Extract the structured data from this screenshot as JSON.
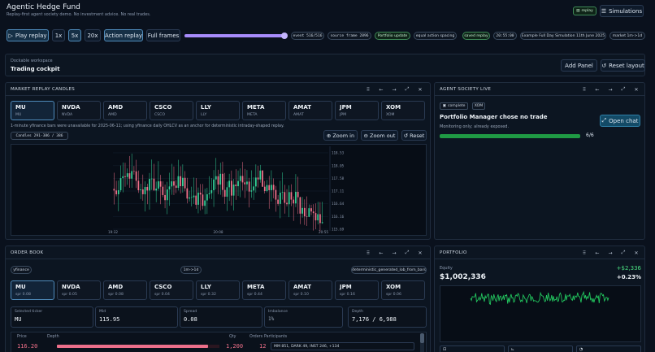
{
  "header": {
    "title": "Agentic Hedge Fund",
    "subtitle": "Replay-first agent society demo. No investment advice. No real trades.",
    "replay_badge": "replay",
    "simulations_label": "Simulations"
  },
  "toolbar": {
    "play_label": "Play replay",
    "speeds": [
      "1x",
      "5x",
      "20x"
    ],
    "active_speed": "5x",
    "action_replay_label": "Action replay",
    "full_frames_label": "Full frames",
    "replay_progress_fraction": 0.98,
    "pills": {
      "event": "event 516/516",
      "source": "source frame 2896",
      "portfolio": "Portfolio update",
      "spacing": "equal action spacing",
      "saved": "saved replay",
      "time": "20:55:00",
      "sim_name": "Example Full Day Simulation 11th June 2025",
      "market": "market 1m->1d"
    }
  },
  "workspace": {
    "label": "Dockable workspace",
    "title": "Trading cockpit",
    "add_panel_label": "Add Panel",
    "reset_layout_label": "Reset layout"
  },
  "market_panel": {
    "title": "MARKET REPLAY CANDLES",
    "tickers": [
      {
        "sym": "MU",
        "sub": "MU"
      },
      {
        "sym": "NVDA",
        "sub": "NVDA"
      },
      {
        "sym": "AMD",
        "sub": "AMD"
      },
      {
        "sym": "CSCO",
        "sub": "CSCO"
      },
      {
        "sym": "LLY",
        "sub": "LLY"
      },
      {
        "sym": "META",
        "sub": "META"
      },
      {
        "sym": "AMAT",
        "sub": "AMAT"
      },
      {
        "sym": "JPM",
        "sub": "JPM"
      },
      {
        "sym": "XOM",
        "sub": "XOM"
      }
    ],
    "selected": "MU",
    "note": "1-minute yfinance bars were unavailable for 2025-06-11; using yfinance daily OHLCV as an anchor for deterministic intraday-shaped replay.",
    "candles_badge": "Candles 291-386 / 386",
    "zoom_in_label": "Zoom in",
    "zoom_out_label": "Zoom out",
    "reset_label": "Reset"
  },
  "chart_data": {
    "type": "candlestick",
    "title": "",
    "xlabel": "",
    "ylabel": "",
    "ylim": [
      115.75,
      118.65
    ],
    "y_ticks": [
      "118.53",
      "118.05",
      "117.58",
      "117.11",
      "116.64",
      "116.16",
      "115.69"
    ],
    "y_tick_values": [
      118.53,
      118.05,
      117.58,
      117.11,
      116.64,
      116.16,
      115.69
    ],
    "x_ticks": [
      "19:32",
      "20:08",
      "20:55"
    ],
    "x_tick_positions": [
      0,
      0.5,
      1
    ],
    "series": [
      {
        "opens": [
          117.19,
          117.13,
          116.99,
          117.14,
          117.59,
          117.66,
          117.63,
          117.77,
          117.57,
          117.85,
          117.84,
          117.49,
          117.14,
          117.17,
          116.99,
          117.26,
          117.13,
          117.56,
          117.57,
          117.13,
          117.2,
          117.47,
          117.27,
          116.96,
          116.77,
          117.17,
          117.28,
          117.47,
          117.31,
          117.23,
          117.66,
          117.29,
          117.6,
          117.21,
          116.83,
          116.87,
          116.88,
          116.94,
          116.6,
          117.05,
          116.98,
          116.56,
          116.76,
          116.99,
          117.03,
          117.14,
          117.54,
          117.66,
          117.35,
          117.75,
          117.15,
          116.9,
          117.25,
          117.49,
          116.94,
          117.35,
          117.29,
          117.48,
          117.67,
          117.43,
          117.36,
          117.46,
          117.09,
          117.13,
          117.28,
          117.61,
          117.54,
          117.87,
          117.27,
          117.11,
          117.33,
          117.14,
          117.34,
          117.15,
          116.79,
          116.63,
          117.05,
          117.07,
          116.67,
          116.62,
          117.07,
          116.79,
          116.65,
          117.08,
          116.88,
          116.27,
          116.48,
          116.17,
          116.15,
          116.47,
          116.35,
          116.29,
          116.02,
          116.25,
          115.92
        ],
        "closes": [
          117.13,
          116.99,
          117.14,
          117.59,
          117.66,
          117.63,
          117.77,
          117.57,
          117.85,
          117.84,
          117.49,
          117.14,
          117.17,
          116.99,
          117.26,
          117.13,
          117.56,
          117.57,
          117.13,
          117.2,
          117.47,
          117.27,
          116.96,
          116.77,
          117.17,
          117.28,
          117.47,
          117.31,
          117.23,
          117.66,
          117.29,
          117.6,
          117.21,
          116.83,
          116.87,
          116.88,
          116.94,
          116.6,
          117.05,
          116.98,
          116.56,
          116.76,
          116.99,
          117.03,
          117.14,
          117.54,
          117.66,
          117.35,
          117.75,
          117.15,
          116.9,
          117.25,
          117.49,
          116.94,
          117.35,
          117.29,
          117.48,
          117.67,
          117.43,
          117.36,
          117.46,
          117.09,
          117.13,
          117.28,
          117.61,
          117.54,
          117.87,
          117.27,
          117.11,
          117.33,
          117.14,
          117.34,
          117.15,
          116.79,
          116.63,
          117.05,
          117.07,
          116.67,
          116.62,
          117.07,
          116.79,
          116.65,
          117.08,
          116.88,
          116.27,
          116.48,
          116.17,
          116.15,
          116.47,
          116.35,
          116.29,
          116.02,
          116.25,
          115.92,
          115.95
        ],
        "highs": [
          117.79,
          117.49,
          117.5,
          118.06,
          118.17,
          118.16,
          117.95,
          118.41,
          118.5,
          118.04,
          118.27,
          117.87,
          117.38,
          117.72,
          117.47,
          117.38,
          117.78,
          118.28,
          118.12,
          117.46,
          118.22,
          117.71,
          117.47,
          117.35,
          117.45,
          117.79,
          118.12,
          118.02,
          117.51,
          118.27,
          118.03,
          118.1,
          117.85,
          117.6,
          117.12,
          117.27,
          117.61,
          117.59,
          117.24,
          117.37,
          117.37,
          117.2,
          117.23,
          117.66,
          117.59,
          117.89,
          118.34,
          117.9,
          118.16,
          118.2,
          117.78,
          117.46,
          117.75,
          117.87,
          117.56,
          117.92,
          117.87,
          117.95,
          118.19,
          117.93,
          117.89,
          117.6,
          117.88,
          117.62,
          118.1,
          118.05,
          118.08,
          117.89,
          117.48,
          117.52,
          117.67,
          117.88,
          117.58,
          117.3,
          116.96,
          117.49,
          117.8,
          117.34,
          117.18,
          117.32,
          117.36,
          116.91,
          117.74,
          117.64,
          116.9,
          116.89,
          116.8,
          116.91,
          116.61,
          116.6,
          116.62,
          116.65,
          116.71,
          116.7,
          116.71
        ],
        "lows": [
          116.61,
          116.91,
          116.36,
          117.07,
          117.06,
          117.27,
          117.34,
          117.23,
          117.23,
          117.72,
          117.22,
          117.04,
          116.81,
          116.75,
          116.35,
          116.62,
          116.42,
          117.15,
          117.13,
          116.69,
          117.12,
          116.62,
          116.88,
          116.47,
          116.25,
          116.56,
          116.97,
          116.96,
          117.03,
          117.13,
          117.02,
          117.05,
          117.1,
          116.65,
          116.72,
          116.54,
          116.63,
          116.45,
          116.28,
          116.39,
          116.43,
          116.25,
          116.26,
          116.83,
          116.81,
          116.52,
          117.17,
          116.99,
          116.97,
          116.89,
          116.63,
          116.37,
          116.74,
          116.57,
          116.39,
          116.78,
          116.93,
          116.88,
          117.13,
          116.85,
          117.12,
          116.5,
          116.86,
          116.78,
          117.05,
          117.24,
          117.42,
          117.26,
          117.02,
          117.06,
          116.45,
          116.72,
          116.84,
          116.34,
          116.56,
          116.1,
          116.79,
          116.27,
          116.54,
          116.14,
          116.55,
          116.0,
          116.51,
          116.26,
          115.88,
          116.12,
          115.85,
          115.81,
          116.14,
          116.21,
          115.64,
          115.69,
          115.87,
          115.61,
          115.89
        ]
      }
    ]
  },
  "agent_panel": {
    "title": "AGENT SOCIETY LIVE",
    "status_pill": "complete",
    "ticker_pill": "XOM",
    "headline": "Portfolio Manager chose no trade",
    "monitoring": "Monitoring only; already exposed.",
    "progress_label": "6/6",
    "progress_fraction": 1,
    "open_chat_label": "Open chat"
  },
  "order_panel": {
    "title": "ORDER BOOK",
    "source_pill": "yfinance",
    "interval_pill": "1m->1d",
    "method_pill": "deterministic_generated_lob_from_bars",
    "tickers": [
      {
        "sym": "MU",
        "sub": "spr 0.08"
      },
      {
        "sym": "NVDA",
        "sub": "spr 0.05"
      },
      {
        "sym": "AMD",
        "sub": "spr 0.08"
      },
      {
        "sym": "CSCO",
        "sub": "spr 0.04"
      },
      {
        "sym": "LLY",
        "sub": "spr 0.32"
      },
      {
        "sym": "META",
        "sub": "spr 0.44"
      },
      {
        "sym": "AMAT",
        "sub": "spr 0.10"
      },
      {
        "sym": "JPM",
        "sub": "spr 0.16"
      },
      {
        "sym": "XOM",
        "sub": "spr 0.06"
      }
    ],
    "stats": {
      "selected_label": "Selected ticker",
      "selected_value": "MU",
      "mid_label": "Mid",
      "mid_value": "115.95",
      "spread_label": "Spread",
      "spread_value": "0.08",
      "imbalance_label": "Imbalance",
      "imbalance_value": "1%",
      "depth_label": "Depth",
      "depth_value": "7,176 / 6,988"
    },
    "table": {
      "headers": [
        "Price",
        "Depth",
        "Qty",
        "Orders",
        "Participants"
      ],
      "row": {
        "price": "116.20",
        "qty": "1,200",
        "orders": "12",
        "participants": "MM 851, DARK 49, INST 246, +134",
        "depth_fraction": 0.93
      }
    }
  },
  "portfolio_panel": {
    "title": "PORTFOLIO",
    "equity_label": "Equity",
    "equity_value": "$1,002,336",
    "pnl": "+$2,336",
    "pnl_pct": "+0.23%",
    "accent": "#22c55e"
  },
  "panel_controls": [
    "⠿",
    "←",
    "→",
    "⤢",
    "✕"
  ]
}
